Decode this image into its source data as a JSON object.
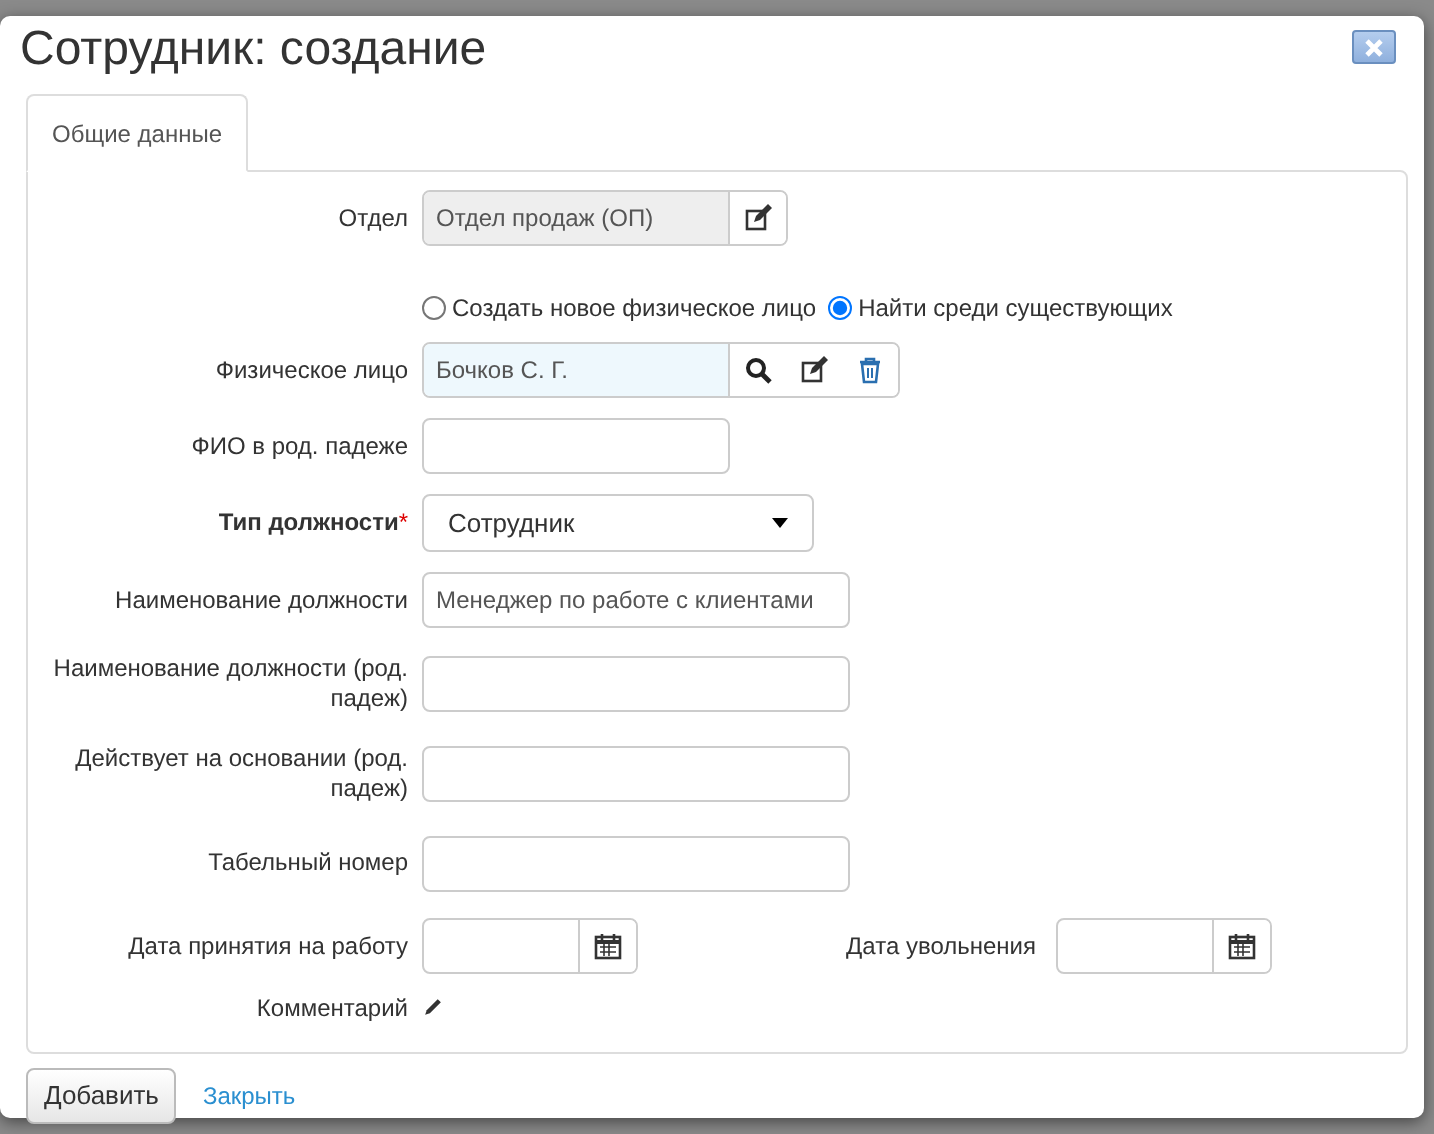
{
  "window": {
    "title": "Сотрудник: создание"
  },
  "tabs": [
    {
      "label": "Общие данные",
      "selected": true
    }
  ],
  "fields": [
    {
      "kind": "locked-lookup",
      "label": "Отдел",
      "value": "Отдел продаж (ОП)"
    },
    {
      "kind": "radios",
      "options": [
        {
          "label": "Создать новое физическое лицо",
          "selected": false
        },
        {
          "label": "Найти среди существующих",
          "selected": true
        }
      ]
    },
    {
      "kind": "lookup",
      "label": "Физическое лицо",
      "value": "Бочков С. Г."
    },
    {
      "kind": "short-text",
      "label": "ФИО в род. падеже"
    },
    {
      "kind": "select",
      "label": "Тип должности",
      "required_mark": "*",
      "value": "Сотрудник"
    },
    {
      "kind": "text",
      "label": "Наименование должности",
      "value": "Менеджер по работе с клиентами"
    },
    {
      "kind": "text",
      "label": "Наименование должности (род. падеж)"
    },
    {
      "kind": "text",
      "label": "Действует на основании (род. падеж)"
    },
    {
      "kind": "text",
      "label": "Табельный номер"
    },
    {
      "kind": "dates",
      "items": [
        {
          "label": "Дата принятия на работу"
        },
        {
          "label": "Дата увольнения"
        }
      ]
    },
    {
      "kind": "comment",
      "label": "Комментарий"
    }
  ],
  "footer": {
    "submit": "Добавить",
    "close_link": "Закрыть"
  }
}
